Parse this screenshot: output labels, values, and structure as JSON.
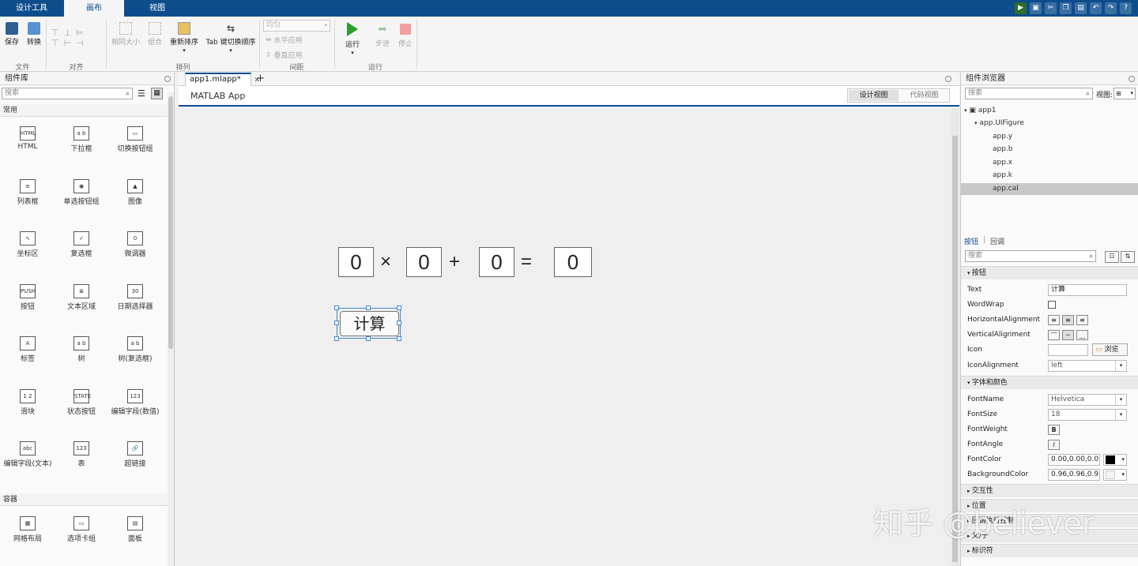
{
  "top_tabs": [
    "设计工具",
    "画布",
    "视图"
  ],
  "quick_access": [
    "run-icon",
    "save-icon",
    "cut-icon",
    "copy-icon",
    "paste-icon",
    "undo-icon",
    "redo-icon",
    "help-icon"
  ],
  "ribbon": {
    "save": "保存",
    "convert": "转换",
    "file_group": "文件",
    "align_group": "对齐",
    "same_size": "相同大小",
    "group": "组合",
    "reorder": "重新排序",
    "tab_order": "Tab 键切换顺序",
    "arrange_group": "排列",
    "spacing_select": "均匀",
    "horizontal_apply": "水平应用",
    "vertical_apply": "垂直应用",
    "spacing_group": "间距",
    "run": "运行",
    "step": "步进",
    "stop": "停止",
    "run_group": "运行"
  },
  "library": {
    "title": "组件库",
    "search_placeholder": "搜索",
    "section_common": "常用",
    "section_containers": "容器",
    "components": [
      {
        "label": "HTML",
        "icon": "HTML"
      },
      {
        "label": "下拉框",
        "icon": "a b"
      },
      {
        "label": "切换按钮组",
        "icon": "▭"
      },
      {
        "label": "列表框",
        "icon": "≡"
      },
      {
        "label": "单选按钮组",
        "icon": "◉"
      },
      {
        "label": "图像",
        "icon": "▲"
      },
      {
        "label": "坐标区",
        "icon": "∿"
      },
      {
        "label": "复选框",
        "icon": "✓"
      },
      {
        "label": "微调器",
        "icon": "0"
      },
      {
        "label": "按钮",
        "icon": "PUSH"
      },
      {
        "label": "文本区域",
        "icon": "≣"
      },
      {
        "label": "日期选择器",
        "icon": "30"
      },
      {
        "label": "标签",
        "icon": "A"
      },
      {
        "label": "树",
        "icon": "a b"
      },
      {
        "label": "树(复选框)",
        "icon": "a b"
      },
      {
        "label": "滑块",
        "icon": "1 2"
      },
      {
        "label": "状态按钮",
        "icon": "STATE"
      },
      {
        "label": "编辑字段(数值)",
        "icon": "123"
      },
      {
        "label": "编辑字段(文本)",
        "icon": "abc"
      },
      {
        "label": "表",
        "icon": "123"
      },
      {
        "label": "超链接",
        "icon": "🔗"
      }
    ],
    "containers": [
      {
        "label": "网格布局",
        "icon": "▦"
      },
      {
        "label": "选项卡组",
        "icon": "▭"
      },
      {
        "label": "面板",
        "icon": "▤"
      }
    ]
  },
  "document": {
    "tab_label": "app1.mlapp*",
    "app_title": "MATLAB App",
    "design_view": "设计视图",
    "code_view": "代码视图",
    "fields": [
      "0",
      "0",
      "0",
      "0"
    ],
    "ops": [
      "×",
      "+",
      "="
    ],
    "calc_button": "计算"
  },
  "browser": {
    "title": "组件浏览器",
    "search_placeholder": "搜索",
    "view_label": "视图:",
    "view_value": "",
    "tree": [
      "app1",
      "app.UIFigure",
      "app.y",
      "app.b",
      "app.x",
      "app.k",
      "app.cal"
    ]
  },
  "inspector": {
    "tab_button": "按钮",
    "tab_callback": "回调",
    "search_placeholder": "搜索",
    "section_button": "按钮",
    "text_label": "Text",
    "text_value": "计算",
    "wordwrap_label": "WordWrap",
    "halign_label": "HorizontalAlignment",
    "valign_label": "VerticalAlignment",
    "icon_label": "Icon",
    "browse": "浏览",
    "iconalign_label": "IconAlignment",
    "iconalign_value": "left",
    "section_font": "字体和颜色",
    "fontname_label": "FontName",
    "fontname_value": "Helvetica",
    "fontsize_label": "FontSize",
    "fontsize_value": "18",
    "fontweight_label": "FontWeight",
    "fontangle_label": "FontAngle",
    "fontcolor_label": "FontColor",
    "fontcolor_value": "0.00,0.00,0.0",
    "bgcolor_label": "BackgroundColor",
    "bgcolor_value": "0.96,0.96,0.9",
    "section_interactivity": "交互性",
    "section_position": "位置",
    "section_callback_exec": "回调执行控制",
    "section_parent": "父/子",
    "section_identifiers": "标识符"
  },
  "watermark": "知乎 @believer",
  "colors": {
    "accent": "#0e4d8c",
    "selection": "#3a8ad8",
    "run_green": "#2aa02a",
    "stop_red": "#e06060"
  }
}
